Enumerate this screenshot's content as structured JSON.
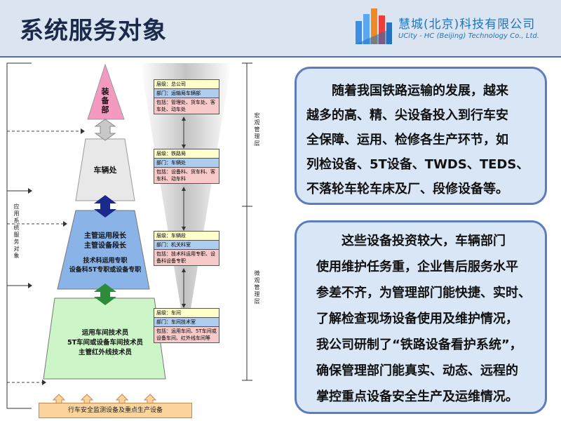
{
  "header": {
    "title": "系统服务对象",
    "company_cn": "慧城(北京)科技有限公司",
    "company_en": "UCity - HC (Beijing) Technology Co., Ltd."
  },
  "diagram": {
    "side_label": "应用系统服务对象",
    "macro_label": "宏观管理层",
    "micro_label": "微观管理层",
    "top_triangle": "装备部",
    "level2": "车辆处",
    "level3": [
      "主管运用段长",
      "主管设备段长",
      "技术科运用专职",
      "设备科5T专职或设备专职"
    ],
    "level4": [
      "运用车间技术员",
      "5T车间或设备车间技术员",
      "主管红外线技术员"
    ],
    "base": "行车安全监测设备及重点生产设备",
    "level_boxes": [
      {
        "level": "层级：总公司",
        "dept": "部门：运输局车辆部",
        "include": "包括：管理处、货车处、客车处、动车处"
      },
      {
        "level": "层级：铁路局",
        "dept": "部门：车辆处",
        "include": "包括：设备科、货车科、客车科、动车科"
      },
      {
        "level": "层级：车辆段",
        "dept": "部门：机关科室",
        "include": "包括：技术科运用专职、设备科设备专职"
      },
      {
        "level": "层级：车间",
        "dept": "部门：车间技术室",
        "include": "包括：运用车间、5T车间或设备车间、红外线车间等"
      }
    ]
  },
  "info": {
    "box1": [
      "随着我国铁路运输的发展，越来",
      "越多的高、精、尖设备投入到行车安",
      "全保障、运用、检修各生产环节，如",
      "列检设备、5T设备、TWDS、TEDS、",
      "不落轮车轮车床及厂、段修设备等。"
    ],
    "box2": [
      "这些设备投资较大，车辆部门",
      "使用维护任务重，企业售后服务水平",
      "参差不齐，为管理部门能快捷、实时、",
      "了解检查现场设备使用及维护情况，",
      "我公司研制了“铁路设备看护系统”，",
      "确保管理部门能真实、动态、远程的",
      "掌控重点设备安全生产及运维情况。"
    ]
  },
  "colors": {
    "header_bg": "#dbe5f1",
    "info_bg": "#d9e6f6",
    "info_border": "#5b7dbb"
  }
}
